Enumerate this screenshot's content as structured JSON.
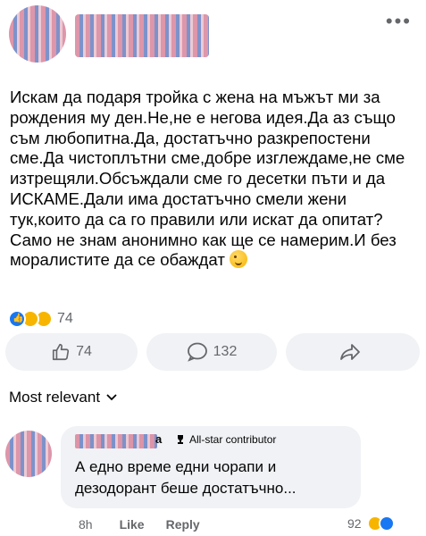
{
  "header": {
    "more_label": "•••"
  },
  "post": {
    "text": "Искам да подаря тройка с жена на мъжът ми за рождения му ден.Не,не е негова идея.Да аз също съм любопитна.Да, достатъчно разкрепостени сме.Да чистоплътни сме,добре изглеждаме,не сме изтрещяли.Обсъждали сме го десетки пъти и да ИСКАМЕ.Дали има достатъчно смели жени тук,които да са го правили или искат да опитат?Само не знам анонимно как ще се намерим.И без моралистите да се обаждат",
    "trailing_emoji": "wink-emoji",
    "reaction_icons": [
      "like-icon",
      "haha-icon",
      "wow-icon"
    ],
    "reactions_count": "74"
  },
  "actions": {
    "like_count": "74",
    "comment_count": "132",
    "share_icon": "share-arrow-icon"
  },
  "comments_section": {
    "sort_label": "Most relevant",
    "comment": {
      "author_tail": "a",
      "badge_label": "All-star contributor",
      "text": "А едно време едни чорапи и дезодорант беше достатъчно...",
      "time": "8h",
      "like_label": "Like",
      "reply_label": "Reply",
      "reactions_count": "92"
    }
  },
  "colors": {
    "like_blue": "#1877f2",
    "button_bg": "#f0f2f5",
    "muted_text": "#65676b"
  }
}
